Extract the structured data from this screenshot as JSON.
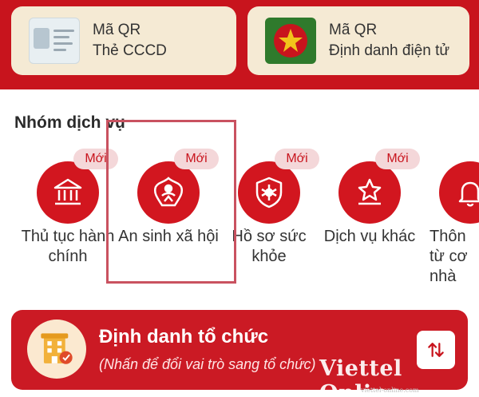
{
  "qr_cards": [
    {
      "line1": "Mã QR",
      "line2": "Thẻ CCCD",
      "icon": "id-card-icon"
    },
    {
      "line1": "Mã QR",
      "line2": "Định danh điện tử",
      "icon": "emblem-icon"
    }
  ],
  "section_title": "Nhóm dịch vụ",
  "services": [
    {
      "badge": "Mới",
      "label": "Thủ tục hành chính",
      "icon": "government-building-icon"
    },
    {
      "badge": "Mới",
      "label": "An sinh xã hội",
      "icon": "social-welfare-icon"
    },
    {
      "badge": "Mới",
      "label": "Hồ sơ sức khỏe",
      "icon": "health-shield-icon"
    },
    {
      "badge": "Mới",
      "label": "Dịch vụ khác",
      "icon": "star-podium-icon"
    },
    {
      "badge": "",
      "label": "Thôn từ cơ nhà",
      "icon": "bell-icon"
    }
  ],
  "org_banner": {
    "title": "Định danh tổ chức",
    "subtitle": "(Nhấn để đổi vai trò sang tổ chức)",
    "icon": "building-badge-icon",
    "button_icon": "swap-arrows-icon"
  },
  "watermark": {
    "main": "Viettel Online",
    "small": "viettel-online.com"
  },
  "colors": {
    "primary_red": "#c8141d",
    "card_cream": "#f5ead4",
    "badge_bg": "#f4d7d9",
    "highlight_border": "#c95260"
  }
}
